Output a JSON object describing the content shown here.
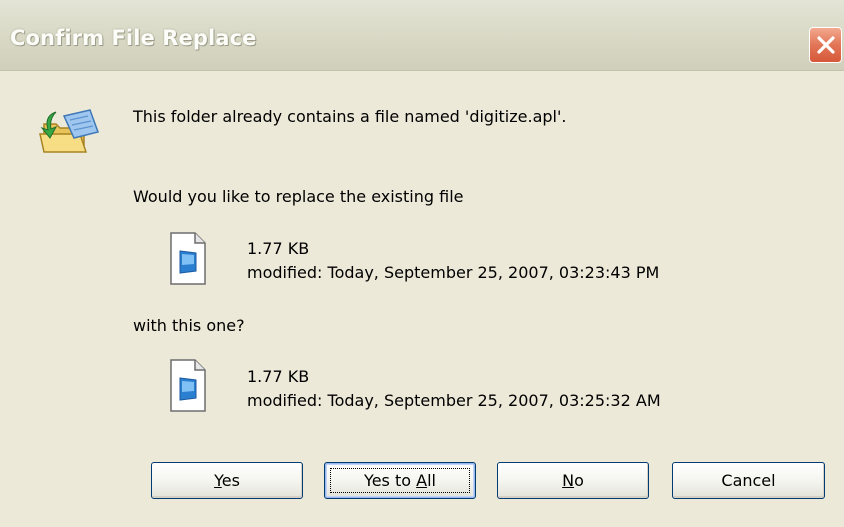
{
  "window": {
    "title": "Confirm File Replace"
  },
  "message": {
    "line1": "This folder already contains a file named 'digitize.apl'.",
    "line2": "Would you like to replace the existing file",
    "line3": "with this one?"
  },
  "existing_file": {
    "size": "1.77 KB",
    "modified": "modified: Today, September 25, 2007, 03:23:43 PM"
  },
  "new_file": {
    "size": "1.77 KB",
    "modified": "modified: Today, September 25, 2007, 03:25:32 AM"
  },
  "buttons": {
    "yes": {
      "mnemonic": "Y",
      "rest": "es"
    },
    "yes_to_all": {
      "before": "Yes to ",
      "mnemonic": "A",
      "after": "ll"
    },
    "no": {
      "mnemonic": "N",
      "rest": "o"
    },
    "cancel": {
      "label": "Cancel"
    }
  },
  "icons": {
    "dialog": "folder-replace-icon",
    "file": "document-icon",
    "close": "close-icon"
  }
}
